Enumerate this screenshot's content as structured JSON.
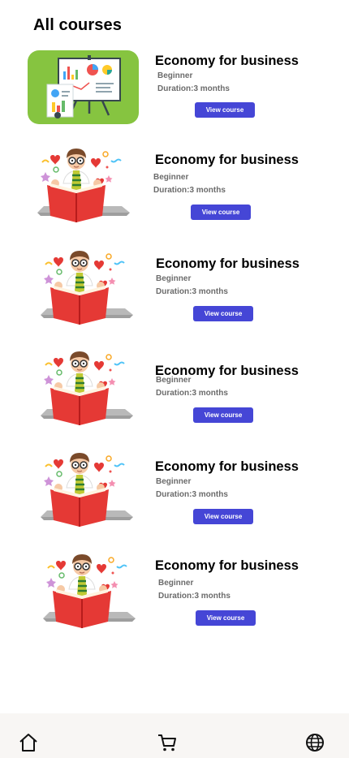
{
  "page": {
    "title": "All courses"
  },
  "courses": [
    {
      "title": "Economy for business",
      "level": "Beginner",
      "duration": "Duration:3 months",
      "button": "View course",
      "thumbnail": "presentation-board"
    },
    {
      "title": "Economy for business",
      "level": "Beginner",
      "duration": "Duration:3 months",
      "button": "View course",
      "thumbnail": "boy-reading-book"
    },
    {
      "title": "Economy for business",
      "level": "Beginner",
      "duration": "Duration:3 months",
      "button": "View course",
      "thumbnail": "boy-reading-book"
    },
    {
      "title": "Economy for business",
      "level": "Beginner",
      "duration": "Duration:3 months",
      "button": "View course",
      "thumbnail": "boy-reading-book"
    },
    {
      "title": "Economy for business",
      "level": "Beginner",
      "duration": "Duration:3 months",
      "button": "View course",
      "thumbnail": "boy-reading-book"
    },
    {
      "title": "Economy for business",
      "level": "Beginner",
      "duration": "Duration:3 months",
      "button": "View course",
      "thumbnail": "boy-reading-book"
    }
  ],
  "nav": {
    "items": [
      {
        "icon": "home-icon"
      },
      {
        "icon": "cart-icon"
      },
      {
        "icon": "globe-icon"
      }
    ]
  },
  "colors": {
    "accent": "#4546d6",
    "nav_background": "#f8f6f4",
    "muted_text": "#6b6b6b"
  }
}
